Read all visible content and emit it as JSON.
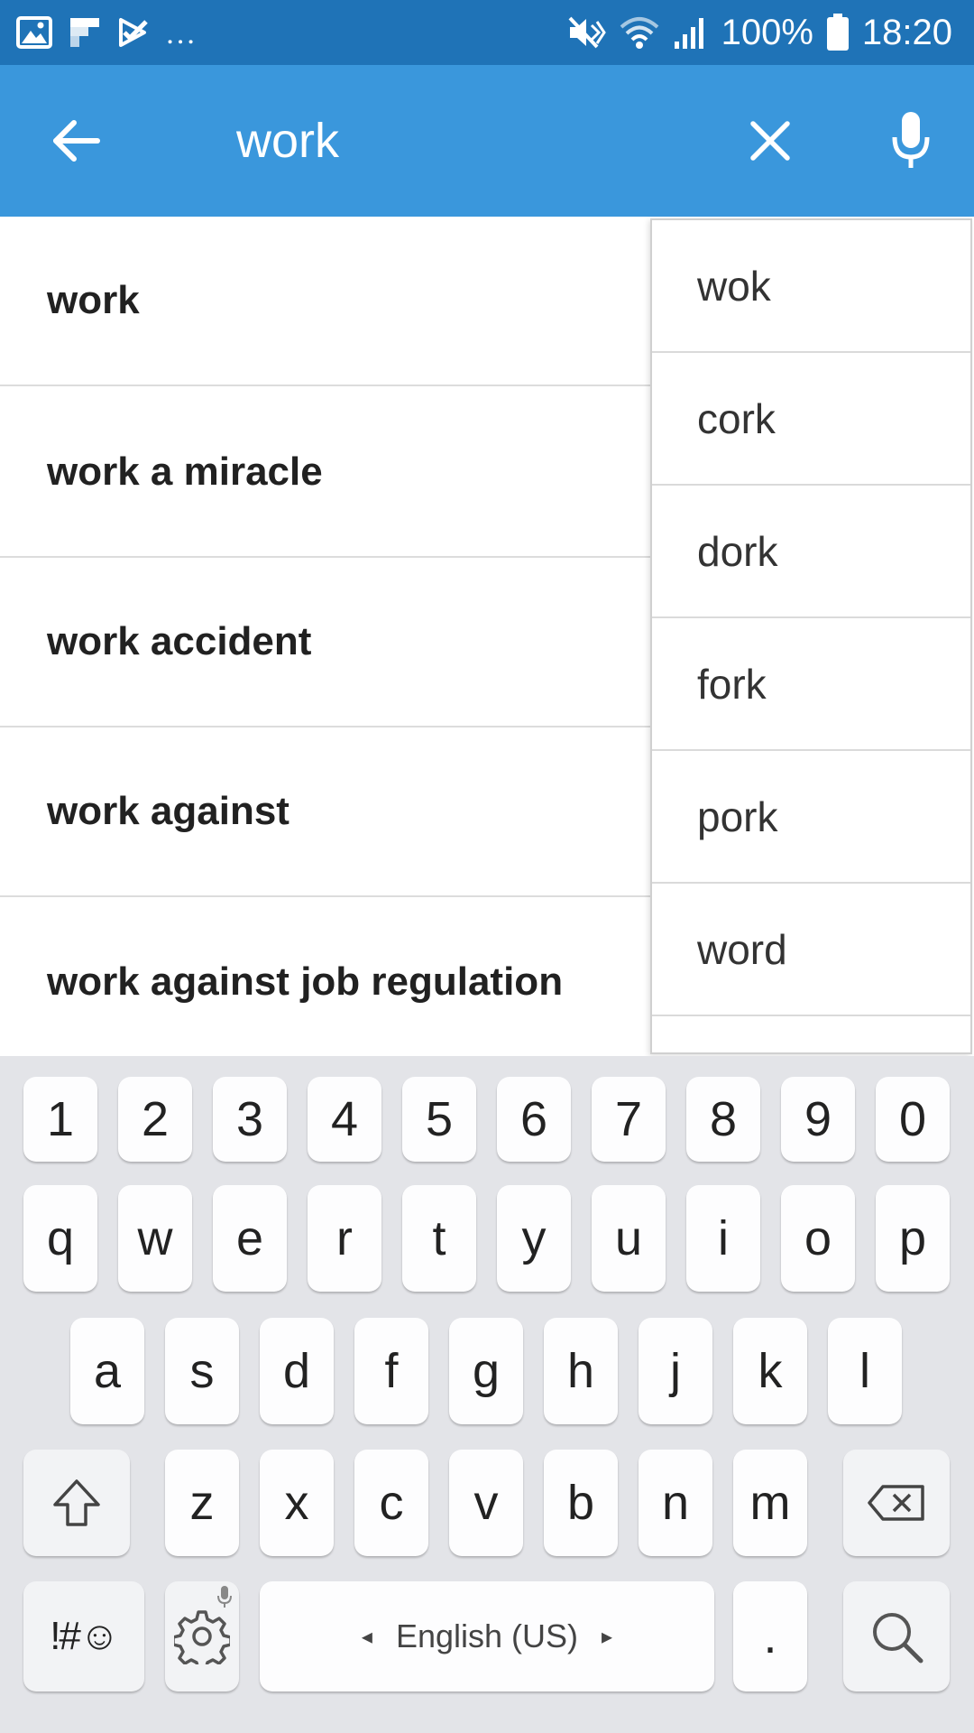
{
  "status_bar": {
    "overflow_dots": "...",
    "battery_percent": "100%",
    "time": "18:20",
    "icons": [
      "gallery-icon",
      "flipboard-icon",
      "checkbox-app-icon",
      "mute-icon",
      "wifi-icon",
      "signal-icon",
      "battery-icon"
    ]
  },
  "app_bar": {
    "background_color": "#3a97dc",
    "search_value": "work"
  },
  "results": [
    {
      "label": "work"
    },
    {
      "label": "work a miracle"
    },
    {
      "label": "work accident"
    },
    {
      "label": "work against"
    },
    {
      "label": "work against job regulation"
    }
  ],
  "suggestions": [
    {
      "label": "wok"
    },
    {
      "label": "cork"
    },
    {
      "label": "dork"
    },
    {
      "label": "fork"
    },
    {
      "label": "pork"
    },
    {
      "label": "word"
    }
  ],
  "keyboard": {
    "number_row": [
      "1",
      "2",
      "3",
      "4",
      "5",
      "6",
      "7",
      "8",
      "9",
      "0"
    ],
    "row1": [
      "q",
      "w",
      "e",
      "r",
      "t",
      "y",
      "u",
      "i",
      "o",
      "p"
    ],
    "row2": [
      "a",
      "s",
      "d",
      "f",
      "g",
      "h",
      "j",
      "k",
      "l"
    ],
    "row3": [
      "z",
      "x",
      "c",
      "v",
      "b",
      "n",
      "m"
    ],
    "symbols_label": "!#☺",
    "space_label": "English (US)",
    "period_label": "."
  }
}
